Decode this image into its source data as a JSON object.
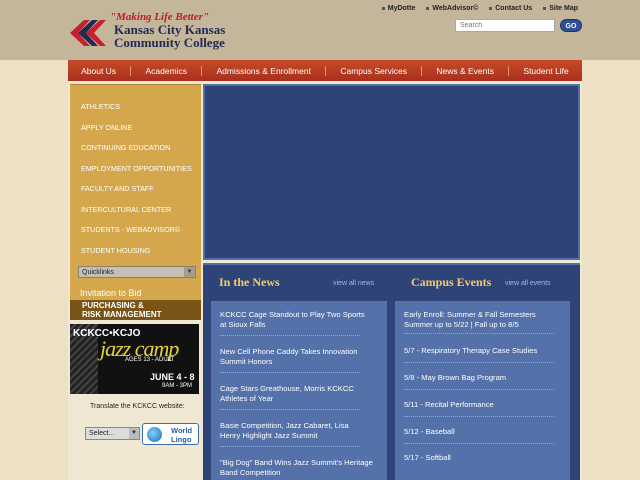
{
  "header": {
    "tagline": "\"Making Life Better\"",
    "college_line1": "Kansas City Kansas",
    "college_line2": "Community College",
    "utility_links": [
      "MyDotte",
      "WebAdvisor©",
      "Contact Us",
      "Site Map"
    ],
    "search_placeholder": "Search",
    "go_label": "GO"
  },
  "nav": [
    "About Us",
    "Academics",
    "Admissions & Enrollment",
    "Campus Services",
    "News & Events",
    "Student Life"
  ],
  "sidebar": {
    "items": [
      "ATHLETICS",
      "APPLY ONLINE",
      "CONTINUING EDUCATION",
      "EMPLOYMENT OPPORTUNITIES",
      "FACULTY AND STAFF",
      "INTERCULTURAL CENTER",
      "STUDENTS - WEBADVISOR©",
      "STUDENT HOUSING"
    ],
    "quicklinks": "Quicklinks",
    "invitation": "Invitation to Bid",
    "purchasing_line1": "PURCHASING &",
    "purchasing_line2": "RISK MANAGEMENT",
    "jazz": {
      "logo": "KCKCC•KCJO",
      "camp": "jazz camp",
      "ages": "AGES 13 - ADULT",
      "dates": "JUNE 4 - 8",
      "time": "9AM - 3PM"
    },
    "translate_label": "Translate the KCKCC website:",
    "select_label": "Select...",
    "worldlingo_line1": "World",
    "worldlingo_line2": "Lingo"
  },
  "news": {
    "heading": "In the News",
    "view_all": "view all news",
    "items": [
      "KCKCC Cage Standout to Play Two Sports at Sioux Falls",
      "New Cell Phone Caddy Takes Innovation Summit Honors",
      "Cage Stars Greathouse, Morris KCKCC Athletes of Year",
      "Basie Competition, Jazz Cabaret, Lisa Henry Highlight Jazz Summit",
      "\"Big Dog\" Band Wins Jazz Summit's Heritage Band Competition"
    ]
  },
  "events": {
    "heading": "Campus Events",
    "view_all": "view all events",
    "items": [
      "Early Enroll: Summer & Fall Semesters Summer up to 5/22 | Fall up to 8/5",
      "5/7 - Respiratory Therapy Case Studies",
      "5/8 - May Brown Bag Program",
      "5/11 - Recital Performance",
      "5/12 - Baseball",
      "5/17 - Softball"
    ]
  },
  "colors": {
    "nav_red": "#b43a22",
    "sidebar_gold": "#d4a74c",
    "navy": "#2e4478",
    "panel_blue": "#5471a9",
    "heading_gold": "#f2cc6a"
  }
}
